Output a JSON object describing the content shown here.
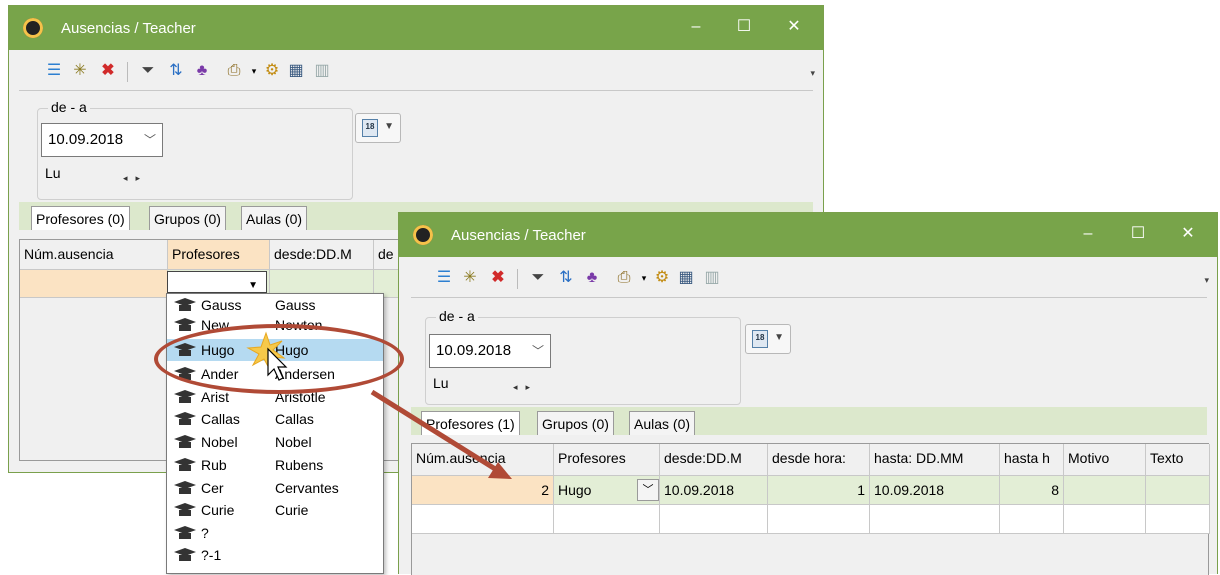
{
  "back_window": {
    "title": "Ausencias / Teacher",
    "controls": {
      "minimize": "–",
      "maximize": "☐",
      "close": "✕"
    },
    "range_label": "de - a",
    "date": "10.09.2018",
    "day": "Lu",
    "tabs": [
      "Profesores (0)",
      "Grupos (0)",
      "Aulas (0)"
    ],
    "columns": [
      "Núm.ausencia",
      "Profesores",
      "desde:DD.M",
      "de"
    ],
    "dropdown_items": [
      {
        "short": "Gauss",
        "long": "Gauss"
      },
      {
        "short": "New",
        "long": "Newton"
      },
      {
        "short": "Hugo",
        "long": "Hugo"
      },
      {
        "short": "Ander",
        "long": "Andersen"
      },
      {
        "short": "Arist",
        "long": "Aristotle"
      },
      {
        "short": "Callas",
        "long": "Callas"
      },
      {
        "short": "Nobel",
        "long": "Nobel"
      },
      {
        "short": "Rub",
        "long": "Rubens"
      },
      {
        "short": "Cer",
        "long": "Cervantes"
      },
      {
        "short": "Curie",
        "long": "Curie"
      },
      {
        "short": "?",
        "long": ""
      },
      {
        "short": "?-1",
        "long": ""
      }
    ],
    "selected_item": "Hugo"
  },
  "front_window": {
    "title": "Ausencias / Teacher",
    "controls": {
      "minimize": "–",
      "maximize": "☐",
      "close": "✕"
    },
    "range_label": "de - a",
    "date": "10.09.2018",
    "day": "Lu",
    "tabs": [
      "Profesores (1)",
      "Grupos (0)",
      "Aulas (0)"
    ],
    "columns": [
      "Núm.ausencia",
      "Profesores",
      "desde:DD.M",
      "desde hora:",
      "hasta: DD.MM",
      "hasta h",
      "Motivo",
      "Texto"
    ],
    "row": {
      "num": "2",
      "profesor": "Hugo",
      "desde": "10.09.2018",
      "desde_hora": "1",
      "hasta": "10.09.2018",
      "hasta_h": "8",
      "motivo": "",
      "texto": ""
    }
  },
  "colors": {
    "titlebar": "#78a44a",
    "tabstrip": "#dce8cc",
    "highlight_header": "#fbe3c3",
    "selection": "#b5daf1",
    "callout": "#b04a36"
  }
}
